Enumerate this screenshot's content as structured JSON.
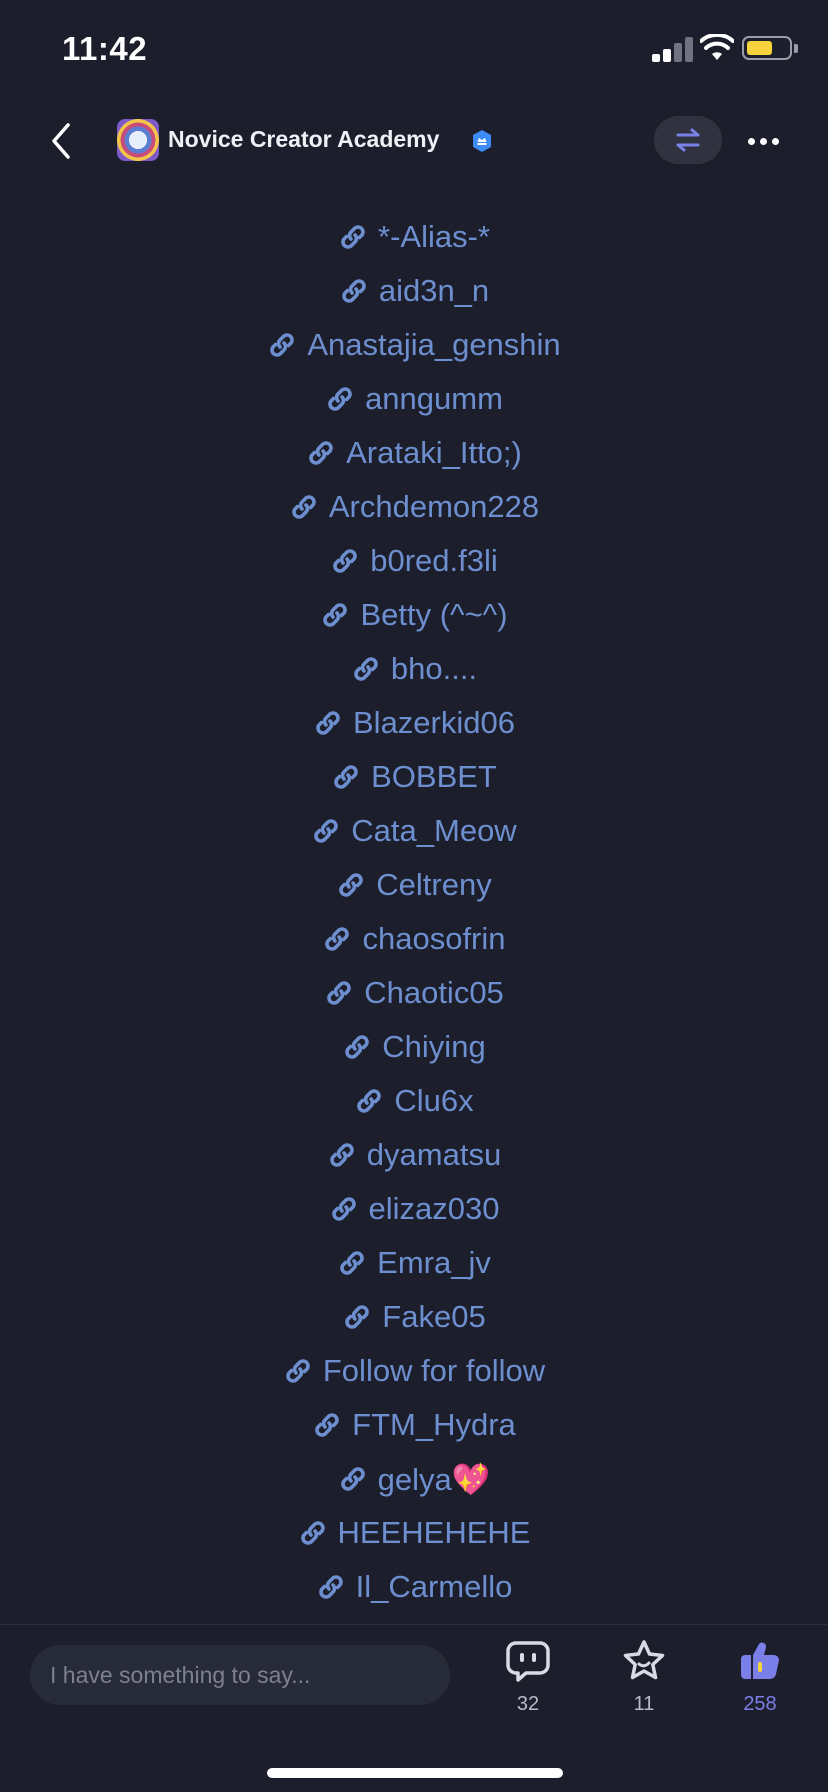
{
  "status_bar": {
    "time": "11:42",
    "icons": [
      "signal-icon",
      "wifi-icon",
      "battery-icon"
    ],
    "battery_level": 0.62,
    "battery_color": "#f5d33a"
  },
  "header": {
    "back_icon": "chevron-left-icon",
    "community_name": "Novice Creator Academy",
    "badge_icon": "verified-badge-icon",
    "swap_icon": "swap-arrows-icon",
    "more_icon": "more-dots-icon"
  },
  "links": [
    {
      "label": "*-Alias-*"
    },
    {
      "label": "aid3n_n"
    },
    {
      "label": "Anastajia_genshin"
    },
    {
      "label": "anngumm"
    },
    {
      "label": "Arataki_Itto;)"
    },
    {
      "label": "Archdemon228"
    },
    {
      "label": "b0red.f3li"
    },
    {
      "label": "Betty (^~^)"
    },
    {
      "label": "bho...."
    },
    {
      "label": "Blazerkid06"
    },
    {
      "label": "BOBBET"
    },
    {
      "label": "Cata_Meow"
    },
    {
      "label": "Celtreny"
    },
    {
      "label": "chaosofrin"
    },
    {
      "label": "Chaotic05"
    },
    {
      "label": "Chiying"
    },
    {
      "label": "Clu6x"
    },
    {
      "label": "dyamatsu"
    },
    {
      "label": "elizaz030"
    },
    {
      "label": "Emra_jv"
    },
    {
      "label": "Fake05"
    },
    {
      "label": "Follow for follow"
    },
    {
      "label": "FTM_Hydra"
    },
    {
      "label": "gelya💖"
    },
    {
      "label": "HEEHEHEHE"
    },
    {
      "label": "Il_Carmello"
    }
  ],
  "link_icon": "link-chain-icon",
  "link_color": "#6d8fcf",
  "bottom_bar": {
    "input_placeholder": "I have something to say...",
    "comments": {
      "icon": "comment-bubble-icon",
      "count": "32"
    },
    "favorites": {
      "icon": "star-icon",
      "count": "11"
    },
    "likes": {
      "icon": "thumbs-up-icon",
      "count": "258",
      "active_color": "#7b7fe8"
    }
  }
}
